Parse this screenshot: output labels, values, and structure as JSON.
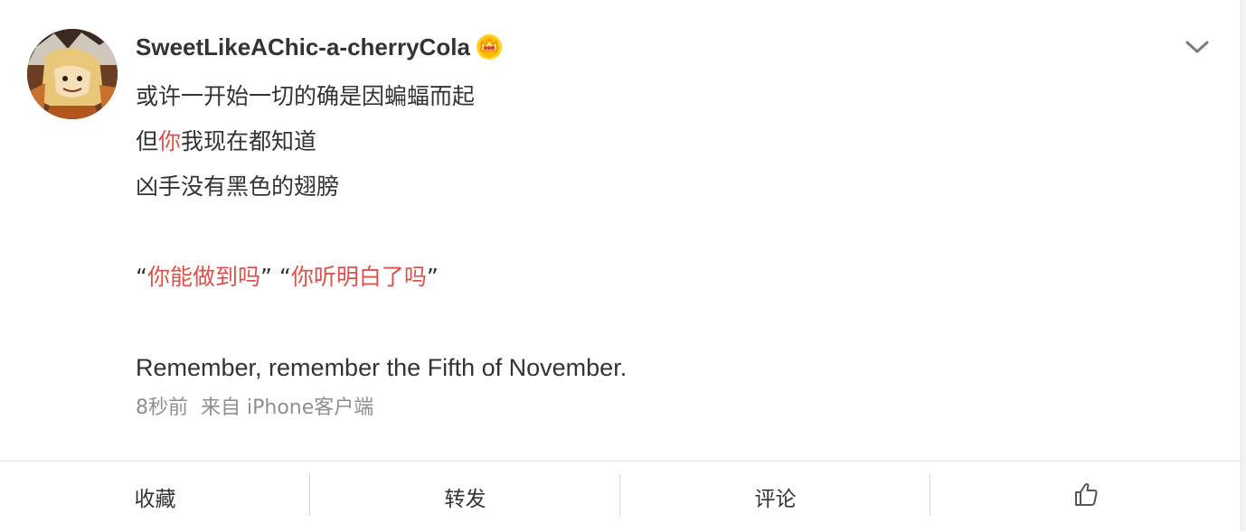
{
  "post": {
    "username": "SweetLikeAChic-a-cherryCola",
    "vip_icon": "crown-badge-icon",
    "menu_icon": "chevron-down-icon",
    "lines": {
      "l1": "或许一开始一切的确是因蝙蝠而起",
      "l2_a": "但",
      "l2_b": "你",
      "l2_c": "我现在都知道",
      "l3": "凶手没有黑色的翅膀",
      "l4_open1": "“",
      "l4_red1": "你能做到吗",
      "l4_close1": "” “",
      "l4_red2": "你听明白了吗",
      "l4_close2": "”",
      "l5": "Remember, remember the Fifth of November."
    },
    "time": "8秒前",
    "source": "来自 iPhone客户端"
  },
  "actions": {
    "collect_label": "收藏",
    "repost_label": "转发",
    "comment_label": "评论",
    "like_icon": "thumbs-up-icon"
  },
  "colors": {
    "highlight": "#e0504a",
    "text": "#333333",
    "meta": "#8f8f8f"
  }
}
